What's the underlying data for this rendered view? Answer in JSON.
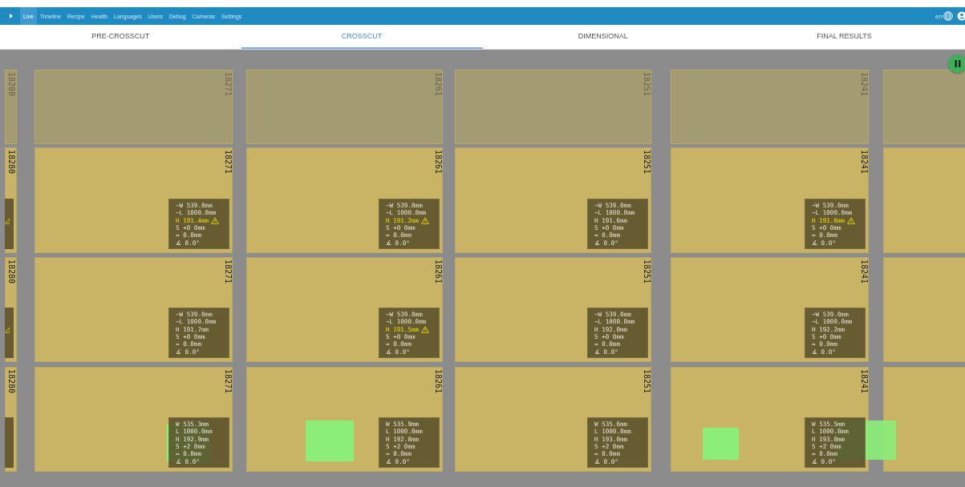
{
  "nav": {
    "items": [
      {
        "label": "Live",
        "selected": true
      },
      {
        "label": "Timeline",
        "selected": false
      },
      {
        "label": "Recipe",
        "selected": false
      },
      {
        "label": "Health",
        "selected": false
      },
      {
        "label": "Languages",
        "selected": false
      },
      {
        "label": "Users",
        "selected": false
      },
      {
        "label": "Debug",
        "selected": false
      },
      {
        "label": "Cameras",
        "selected": false
      },
      {
        "label": "Settings",
        "selected": false
      }
    ],
    "language": "en"
  },
  "tabs": [
    {
      "label": "PRE-CROSSCUT",
      "selected": false
    },
    {
      "label": "CROSSCUT",
      "selected": true
    },
    {
      "label": "DIMENSIONAL",
      "selected": false
    },
    {
      "label": "FINAL RESULTS",
      "selected": false
    }
  ],
  "columns": [
    {
      "cells": [
        {
          "kind": "pending",
          "id": "18280"
        },
        {
          "kind": "clipped",
          "id": "18280",
          "warning": true
        },
        {
          "kind": "clipped",
          "id": "18280",
          "warning": true
        },
        {
          "kind": "clipped",
          "id": "18280",
          "warning": false
        }
      ]
    },
    {
      "cells": [
        {
          "kind": "pending",
          "id": "18271"
        },
        {
          "kind": "measured",
          "id": "18271",
          "readings": [
            {
              "text": "~W 539.0mm",
              "warning": false
            },
            {
              "text": "~L 1000.0mm",
              "warning": false
            },
            {
              "text": "H 191.4mm",
              "warning": true
            },
            {
              "text": "S +0 0mm",
              "warning": false
            },
            {
              "text": "↔ 0.0mm",
              "warning": false
            },
            {
              "text": "∡ 0.0°",
              "warning": false
            }
          ]
        },
        {
          "kind": "measured",
          "id": "18271",
          "readings": [
            {
              "text": "~W 539.0mm",
              "warning": false
            },
            {
              "text": "~L 1000.0mm",
              "warning": false
            },
            {
              "text": "H 191.7mm",
              "warning": false
            },
            {
              "text": "S +0 0mm",
              "warning": false
            },
            {
              "text": "↔ 0.0mm",
              "warning": false
            },
            {
              "text": "∡ 0.0°",
              "warning": false
            }
          ]
        },
        {
          "kind": "measured",
          "id": "18271",
          "readings": [
            {
              "text": "W 535.3mm",
              "warning": false
            },
            {
              "text": "L 1000.0mm",
              "warning": false
            },
            {
              "text": "H 192.9mm",
              "warning": false
            },
            {
              "text": "S +2 0mm",
              "warning": false
            },
            {
              "text": "↔ 0.0mm",
              "warning": false
            },
            {
              "text": "∡ 0.0°",
              "warning": false
            }
          ]
        }
      ]
    },
    {
      "cells": [
        {
          "kind": "pending",
          "id": "18261"
        },
        {
          "kind": "measured",
          "id": "18261",
          "readings": [
            {
              "text": "~W 539.0mm",
              "warning": false
            },
            {
              "text": "~L 1000.0mm",
              "warning": false
            },
            {
              "text": "H 191.2mm",
              "warning": true
            },
            {
              "text": "S +0 0mm",
              "warning": false
            },
            {
              "text": "↔ 0.0mm",
              "warning": false
            },
            {
              "text": "∡ 0.0°",
              "warning": false
            }
          ]
        },
        {
          "kind": "measured",
          "id": "18261",
          "readings": [
            {
              "text": "~W 539.0mm",
              "warning": false
            },
            {
              "text": "~L 1000.0mm",
              "warning": false
            },
            {
              "text": "H 191.5mm",
              "warning": true
            },
            {
              "text": "S +0 0mm",
              "warning": false
            },
            {
              "text": "↔ 0.0mm",
              "warning": false
            },
            {
              "text": "∡ 0.0°",
              "warning": false
            }
          ]
        },
        {
          "kind": "measured",
          "id": "18261",
          "readings": [
            {
              "text": "W 535.9mm",
              "warning": false
            },
            {
              "text": "L 1000.0mm",
              "warning": false
            },
            {
              "text": "H 192.8mm",
              "warning": false
            },
            {
              "text": "S +2 0mm",
              "warning": false
            },
            {
              "text": "↔ 0.0mm",
              "warning": false
            },
            {
              "text": "∡ 0.0°",
              "warning": false
            }
          ]
        }
      ]
    },
    {
      "cells": [
        {
          "kind": "pending",
          "id": "18251"
        },
        {
          "kind": "measured",
          "id": "18251",
          "readings": [
            {
              "text": "~W 539.0mm",
              "warning": false
            },
            {
              "text": "~L 1000.0mm",
              "warning": false
            },
            {
              "text": "H 191.6mm",
              "warning": false
            },
            {
              "text": "S +0 0mm",
              "warning": false
            },
            {
              "text": "↔ 0.0mm",
              "warning": false
            },
            {
              "text": "∡ 0.0°",
              "warning": false
            }
          ]
        },
        {
          "kind": "measured",
          "id": "18251",
          "readings": [
            {
              "text": "~W 539.0mm",
              "warning": false
            },
            {
              "text": "~L 1000.0mm",
              "warning": false
            },
            {
              "text": "H 192.0mm",
              "warning": false
            },
            {
              "text": "S +0 0mm",
              "warning": false
            },
            {
              "text": "↔ 0.0mm",
              "warning": false
            },
            {
              "text": "∡ 0.0°",
              "warning": false
            }
          ]
        },
        {
          "kind": "measured",
          "id": "18251",
          "readings": [
            {
              "text": "W 535.6mm",
              "warning": false
            },
            {
              "text": "L 1000.0mm",
              "warning": false
            },
            {
              "text": "H 193.0mm",
              "warning": false
            },
            {
              "text": "S +2 0mm",
              "warning": false
            },
            {
              "text": "↔ 0.0mm",
              "warning": false
            },
            {
              "text": "∡ 0.0°",
              "warning": false
            }
          ]
        }
      ]
    },
    {
      "cells": [
        {
          "kind": "pending",
          "id": "18241"
        },
        {
          "kind": "measured",
          "id": "18241",
          "readings": [
            {
              "text": "~W 539.0mm",
              "warning": false
            },
            {
              "text": "~L 1000.0mm",
              "warning": false
            },
            {
              "text": "H 191.6mm",
              "warning": true
            },
            {
              "text": "S +0 0mm",
              "warning": false
            },
            {
              "text": "↔ 0.0mm",
              "warning": false
            },
            {
              "text": "∡ 0.0°",
              "warning": false
            }
          ]
        },
        {
          "kind": "measured",
          "id": "18241",
          "readings": [
            {
              "text": "~W 539.0mm",
              "warning": false
            },
            {
              "text": "~L 1000.0mm",
              "warning": false
            },
            {
              "text": "H 192.2mm",
              "warning": false
            },
            {
              "text": "S +0 0mm",
              "warning": false
            },
            {
              "text": "↔ 0.0mm",
              "warning": false
            },
            {
              "text": "∡ 0.0°",
              "warning": false
            }
          ]
        },
        {
          "kind": "measured",
          "id": "18241",
          "readings": [
            {
              "text": "W 535.5mm",
              "warning": false
            },
            {
              "text": "L 1000.0mm",
              "warning": false
            },
            {
              "text": "H 193.0mm",
              "warning": false
            },
            {
              "text": "S +2 0mm",
              "warning": false
            },
            {
              "text": "↔ 0.0mm",
              "warning": false
            },
            {
              "text": "∡ 0.0°",
              "warning": false
            }
          ]
        }
      ]
    },
    {
      "cells": [
        {
          "kind": "blank_pending"
        },
        {
          "kind": "blank"
        },
        {
          "kind": "blank"
        },
        {
          "kind": "blank"
        }
      ]
    }
  ]
}
